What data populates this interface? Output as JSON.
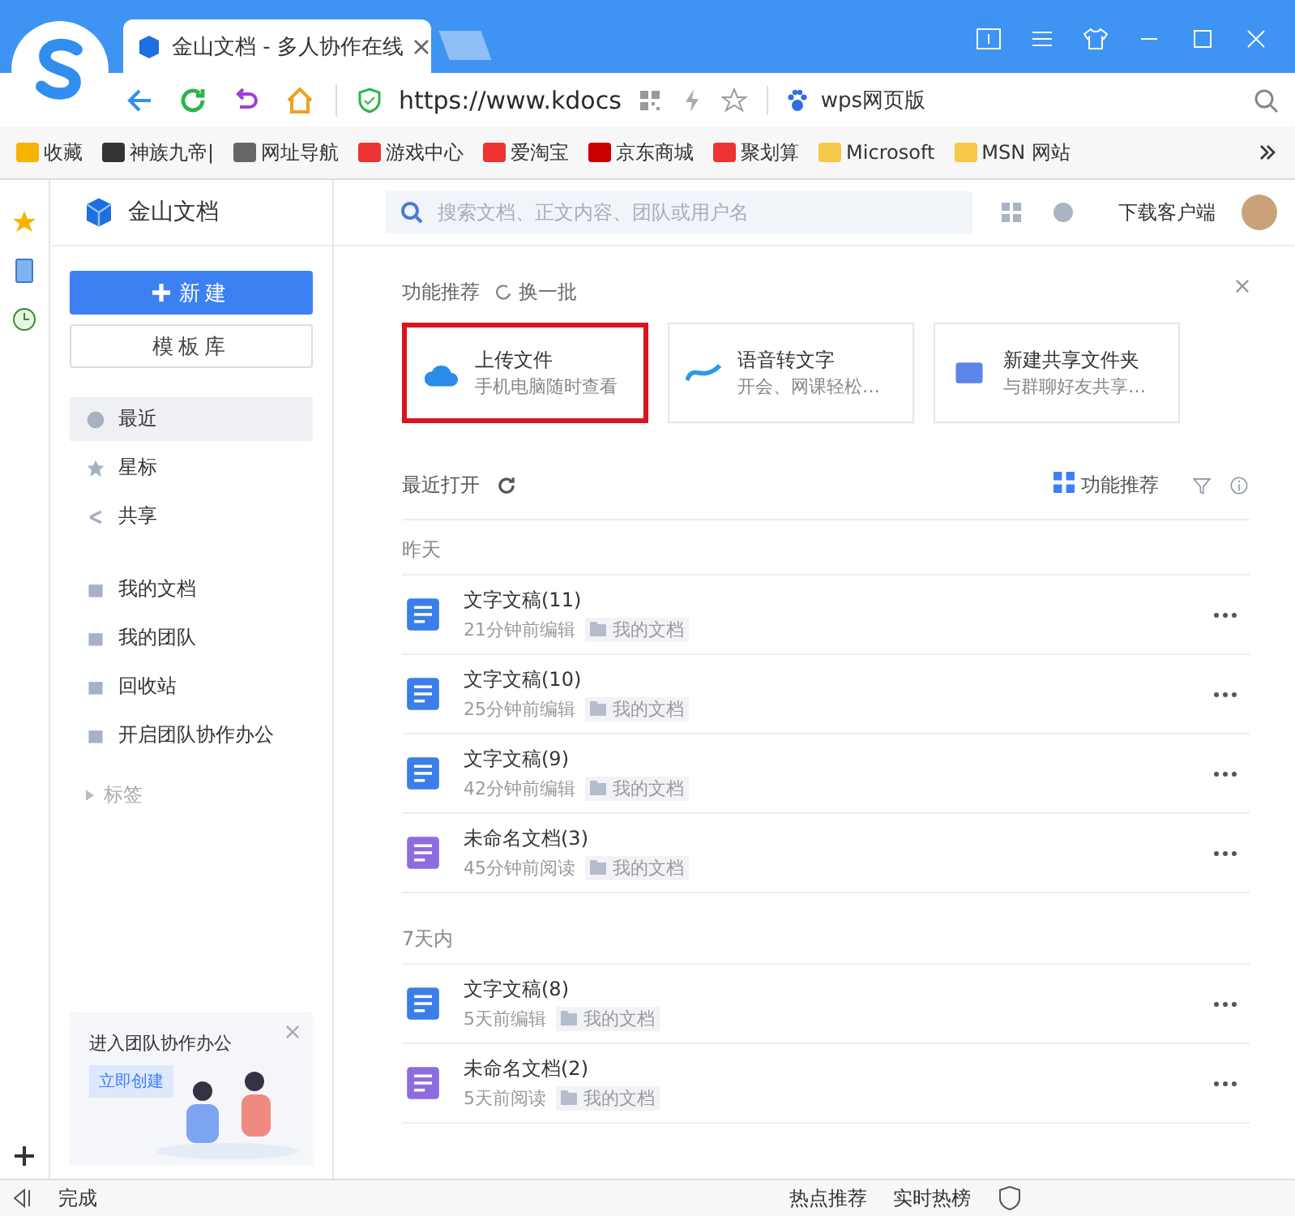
{
  "browser": {
    "tab_title": "金山文档 - 多人协作在线",
    "url": "https://www.kdocs",
    "search_text": "wps网页版",
    "bookmarks": [
      {
        "label": "收藏"
      },
      {
        "label": "神族九帝|"
      },
      {
        "label": "网址导航"
      },
      {
        "label": "游戏中心"
      },
      {
        "label": "爱淘宝"
      },
      {
        "label": "京东商城"
      },
      {
        "label": "聚划算"
      },
      {
        "label": "Microsoft"
      },
      {
        "label": "MSN 网站"
      }
    ],
    "status": "完成",
    "status_items": [
      "热点推荐",
      "实时热榜"
    ]
  },
  "app": {
    "logo": "金山文档",
    "search_placeholder": "搜索文档、正文内容、团队或用户名",
    "download": "下载客户端",
    "new_button": "新建",
    "template_button": "模板库",
    "nav": [
      {
        "label": "最近",
        "selected": true
      },
      {
        "label": "星标",
        "selected": false
      },
      {
        "label": "共享",
        "selected": false
      },
      {
        "label": "我的文档",
        "selected": false
      },
      {
        "label": "我的团队",
        "selected": false
      },
      {
        "label": "回收站",
        "selected": false
      },
      {
        "label": "开启团队协作办公",
        "selected": false
      }
    ],
    "tags": "标签",
    "promo": {
      "title": "进入团队协作办公",
      "button": "立即创建"
    }
  },
  "recommend": {
    "title": "功能推荐",
    "refresh": "换一批",
    "cards": [
      {
        "title": "上传文件",
        "subtitle": "手机电脑随时查看",
        "highlighted": true
      },
      {
        "title": "语音转文字",
        "subtitle": "开会、网课轻松…",
        "highlighted": false
      },
      {
        "title": "新建共享文件夹",
        "subtitle": "与群聊好友共享…",
        "highlighted": false
      }
    ]
  },
  "recent": {
    "title": "最近打开",
    "view": "功能推荐",
    "groups": [
      {
        "label": "昨天",
        "files": [
          {
            "kind": "doc",
            "name": "文字文稿(11)",
            "meta": "21分钟前编辑",
            "folder": "我的文档"
          },
          {
            "kind": "doc",
            "name": "文字文稿(10)",
            "meta": "25分钟前编辑",
            "folder": "我的文档"
          },
          {
            "kind": "doc",
            "name": "文字文稿(9)",
            "meta": "42分钟前编辑",
            "folder": "我的文档"
          },
          {
            "kind": "note",
            "name": "未命名文档(3)",
            "meta": "45分钟前阅读",
            "folder": "我的文档"
          }
        ]
      },
      {
        "label": "7天内",
        "files": [
          {
            "kind": "doc",
            "name": "文字文稿(8)",
            "meta": "5天前编辑",
            "folder": "我的文档"
          },
          {
            "kind": "note",
            "name": "未命名文档(2)",
            "meta": "5天前阅读",
            "folder": "我的文档"
          }
        ]
      }
    ]
  }
}
